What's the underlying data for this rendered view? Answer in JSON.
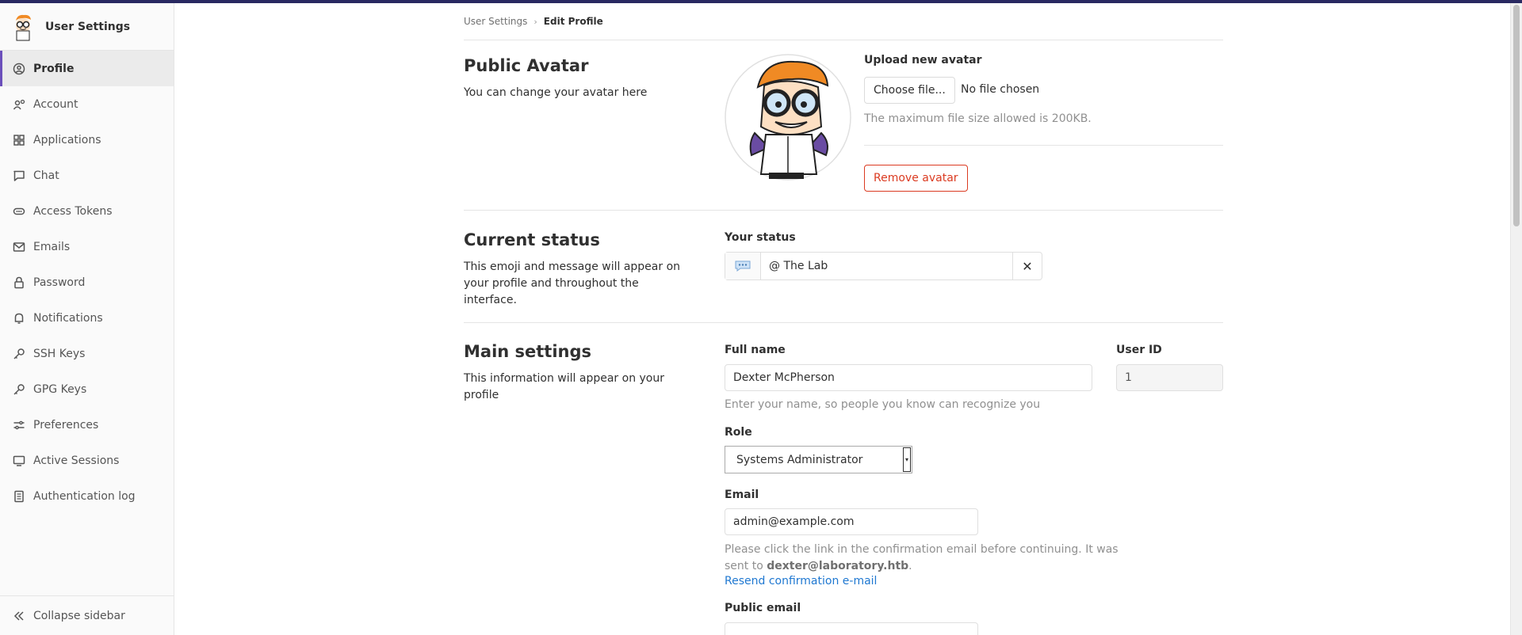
{
  "sidebar": {
    "title": "User Settings",
    "items": [
      {
        "label": "Profile",
        "icon": "profile-icon",
        "active": true
      },
      {
        "label": "Account",
        "icon": "account-icon"
      },
      {
        "label": "Applications",
        "icon": "applications-icon"
      },
      {
        "label": "Chat",
        "icon": "chat-icon"
      },
      {
        "label": "Access Tokens",
        "icon": "token-icon"
      },
      {
        "label": "Emails",
        "icon": "mail-icon"
      },
      {
        "label": "Password",
        "icon": "lock-icon"
      },
      {
        "label": "Notifications",
        "icon": "bell-icon"
      },
      {
        "label": "SSH Keys",
        "icon": "key-icon"
      },
      {
        "label": "GPG Keys",
        "icon": "key-icon"
      },
      {
        "label": "Preferences",
        "icon": "preferences-icon"
      },
      {
        "label": "Active Sessions",
        "icon": "monitor-icon"
      },
      {
        "label": "Authentication log",
        "icon": "log-icon"
      }
    ],
    "collapse_label": "Collapse sidebar"
  },
  "breadcrumb": {
    "parent": "User Settings",
    "current": "Edit Profile"
  },
  "avatar": {
    "title": "Public Avatar",
    "description": "You can change your avatar here",
    "upload_label": "Upload new avatar",
    "choose_file": "Choose file...",
    "no_file": "No file chosen",
    "max_size": "The maximum file size allowed is 200KB.",
    "remove": "Remove avatar"
  },
  "status": {
    "title": "Current status",
    "description": "This emoji and message will appear on your profile and throughout the interface.",
    "label": "Your status",
    "value": "@ The Lab"
  },
  "main_settings": {
    "title": "Main settings",
    "description": "This information will appear on your profile",
    "full_name_label": "Full name",
    "full_name": "Dexter McPherson",
    "full_name_help": "Enter your name, so people you know can recognize you",
    "user_id_label": "User ID",
    "user_id": "1",
    "role_label": "Role",
    "role": "Systems Administrator",
    "email_label": "Email",
    "email": "admin@example.com",
    "email_help": "Please click the link in the confirmation email before continuing. It was sent to",
    "email_sent_to": "dexter@laboratory.htb",
    "email_period": ".",
    "resend": "Resend confirmation e-mail",
    "public_email_label": "Public email"
  },
  "colors": {
    "accent": "#6b4fbb",
    "topbar": "#292961",
    "danger": "#db3b21",
    "link": "#1f78d1"
  }
}
